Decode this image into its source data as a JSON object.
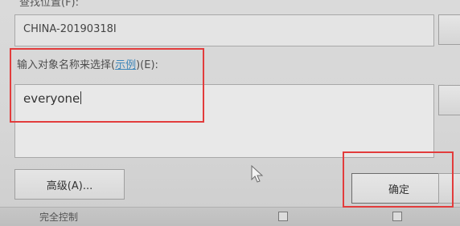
{
  "dialog": {
    "location_label": "查找位置(F):",
    "location_value": "CHINA-20190318I",
    "object_names_label_prefix": "输入对象名称来选择(",
    "object_names_link": "示例",
    "object_names_label_suffix": ")(E):",
    "object_names_value": "everyone",
    "advanced_button_label": "高级(A)...",
    "ok_button_label": "确定"
  },
  "background_permissions": {
    "full_control_label": "完全控制"
  },
  "colors": {
    "highlight_box": "#e23c3c",
    "link": "#3f86b9"
  }
}
